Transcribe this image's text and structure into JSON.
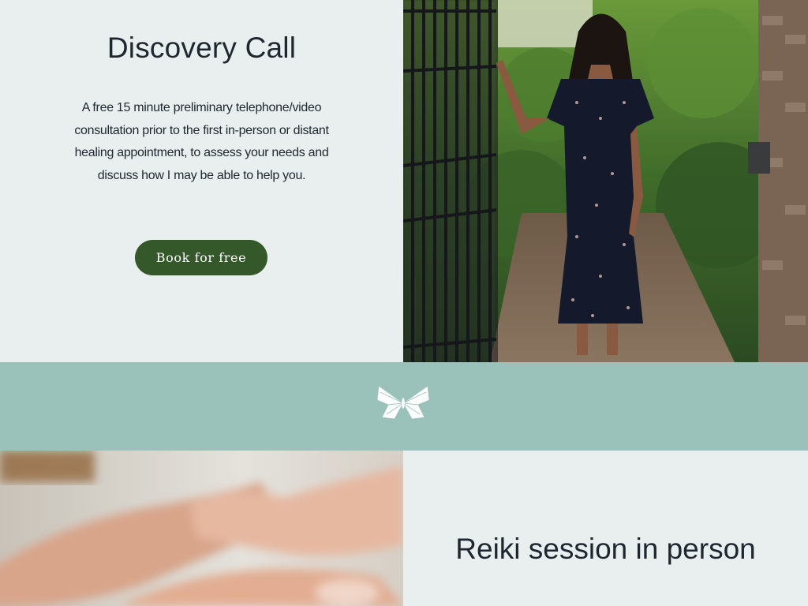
{
  "discovery": {
    "title": "Discovery Call",
    "description": "A free 15 minute preliminary telephone/video consultation prior to the first in-person or distant healing appointment, to assess your needs and discuss how I may be able to help you.",
    "cta_label": "Book for free"
  },
  "images": {
    "top_photo": "photo-woman-at-iron-gate",
    "divider_icon": "butterfly-icon",
    "bottom_photo": "photo-reiki-hands"
  },
  "reiki": {
    "title": "Reiki session in person"
  },
  "colors": {
    "panel_bg": "#e8efee",
    "band_bg": "#9ac2ba",
    "button_bg": "#34582a",
    "text": "#1f2630"
  }
}
